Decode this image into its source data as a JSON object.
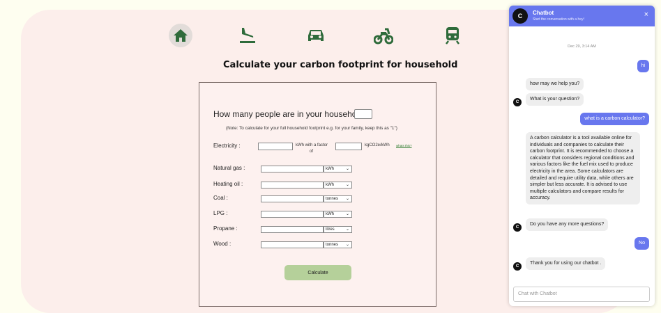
{
  "nav": {
    "items": [
      {
        "icon": "home-icon",
        "active": true
      },
      {
        "icon": "flight-icon",
        "active": false
      },
      {
        "icon": "car-icon",
        "active": false
      },
      {
        "icon": "motorbike-icon",
        "active": false
      },
      {
        "icon": "train-icon",
        "active": false
      }
    ],
    "active_bg": "#e2dcd9",
    "icon_color": "#2f6b3b"
  },
  "page": {
    "title": "Calculate your carbon footprint for household"
  },
  "form": {
    "people_question": "How many people are in your household?",
    "people_value": "",
    "note": "(Note: To calculate for your full household footprint e.g. for your family, keep this as \"1\")",
    "electricity": {
      "label": "Electricity :",
      "with_factor": "kWh with a factor",
      "of": "of",
      "unit": "kgCO2e/kWh",
      "link": "whats this?"
    },
    "fuels": [
      {
        "label": "Natural gas :",
        "unit": "kWh"
      },
      {
        "label": "Heating oil :",
        "unit": "kWh"
      },
      {
        "label": "Coal :",
        "unit": "tonnes"
      },
      {
        "label": "LPG :",
        "unit": "kWh"
      },
      {
        "label": "Propane :",
        "unit": "litres"
      },
      {
        "label": "Wood :",
        "unit": "tonnes"
      }
    ],
    "calculate_label": "Calculate"
  },
  "chat": {
    "avatar_letter": "C",
    "title": "Chatbot",
    "subtitle": "Start the conversation with a hey!",
    "close": "×",
    "date": "Dec 29, 3:14 AM",
    "messages": [
      {
        "from": "user",
        "text": "hi"
      },
      {
        "from": "bot",
        "text": "how may we help you?"
      },
      {
        "from": "bot",
        "text": "What is your question?"
      },
      {
        "from": "user",
        "text": "what is a carbon calculator?"
      },
      {
        "from": "bot",
        "text": "A carbon calculator is a tool available online for individuals and companies to calculate their carbon footprint. It is recommended to choose a calculator that considers regional conditions and various factors like the fuel mix used to produce electricity in the area. Some calculators are detailed and require utility data, while others are simpler but less accurate. It is advised to use multiple calculators and compare results for accuracy."
      },
      {
        "from": "bot",
        "text": "Do you have any more questions?"
      },
      {
        "from": "user",
        "text": "No"
      },
      {
        "from": "bot",
        "text": "Thank you for using our chatbot ."
      }
    ],
    "input_placeholder": "Chat with Chatbot",
    "colors": {
      "accent": "#6877ee",
      "bot_bubble": "#eeeeee"
    }
  }
}
